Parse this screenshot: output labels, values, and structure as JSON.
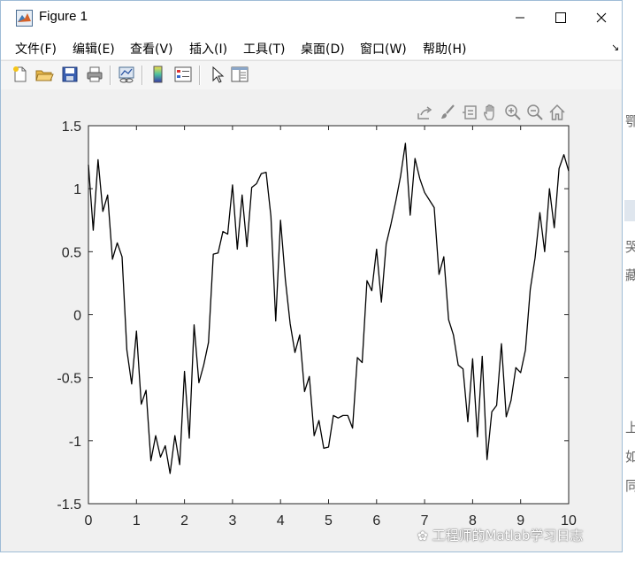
{
  "window": {
    "title": "Figure 1",
    "minimize_glyph": "—",
    "maximize_glyph": "☐",
    "close_glyph": "✕"
  },
  "menu": [
    {
      "label": "文件(F)"
    },
    {
      "label": "编辑(E)"
    },
    {
      "label": "查看(V)"
    },
    {
      "label": "插入(I)"
    },
    {
      "label": "工具(T)"
    },
    {
      "label": "桌面(D)"
    },
    {
      "label": "窗口(W)"
    },
    {
      "label": "帮助(H)"
    }
  ],
  "menu_overflow_glyph": "↘",
  "toolbar": [
    "new-figure-icon",
    "open-file-icon",
    "save-icon",
    "print-icon",
    "link-plot-icon",
    "colorbar-icon",
    "legend-icon",
    "select-pointer-icon",
    "property-inspector-icon"
  ],
  "axes_toolbar": [
    "export-icon",
    "brush-icon",
    "data-tips-icon",
    "pan-hand-icon",
    "zoom-in-icon",
    "zoom-out-icon",
    "home-icon"
  ],
  "colors": {
    "line": "#000000",
    "axes_bg": "#ffffff",
    "figure_bg": "#f0f0f0"
  },
  "chart_data": {
    "type": "line",
    "title": "",
    "xlabel": "",
    "ylabel": "",
    "xlim": [
      0,
      10
    ],
    "ylim": [
      -1.5,
      1.5
    ],
    "xticks": [
      "0",
      "1",
      "2",
      "3",
      "4",
      "5",
      "6",
      "7",
      "8",
      "9",
      "10"
    ],
    "yticks": [
      "-1.5",
      "-1",
      "-0.5",
      "0",
      "0.5",
      "1",
      "1.5"
    ],
    "grid": false,
    "series": [
      {
        "color": "#000000",
        "x": [
          0,
          0.1,
          0.2,
          0.3,
          0.4,
          0.5,
          0.6,
          0.7,
          0.8,
          0.9,
          1.0,
          1.1,
          1.2,
          1.3,
          1.4,
          1.5,
          1.6,
          1.7,
          1.8,
          1.9,
          2.0,
          2.1,
          2.2,
          2.3,
          2.4,
          2.5,
          2.6,
          2.7,
          2.8,
          2.9,
          3.0,
          3.1,
          3.2,
          3.3,
          3.4,
          3.5,
          3.6,
          3.7,
          3.8,
          3.9,
          4.0,
          4.1,
          4.2,
          4.3,
          4.4,
          4.5,
          4.6,
          4.7,
          4.8,
          4.9,
          5.0,
          5.1,
          5.2,
          5.3,
          5.4,
          5.5,
          5.6,
          5.7,
          5.8,
          5.9,
          6.0,
          6.1,
          6.2,
          6.3,
          6.4,
          6.5,
          6.6,
          6.7,
          6.8,
          6.9,
          7.0,
          7.1,
          7.2,
          7.3,
          7.4,
          7.5,
          7.6,
          7.7,
          7.8,
          7.9,
          8.0,
          8.1,
          8.2,
          8.3,
          8.4,
          8.5,
          8.6,
          8.7,
          8.8,
          8.9,
          9.0,
          9.1,
          9.2,
          9.3,
          9.4,
          9.5,
          9.6,
          9.7,
          9.8,
          9.9,
          10.0
        ],
        "y": [
          1.19,
          0.67,
          1.23,
          0.82,
          0.95,
          0.44,
          0.57,
          0.46,
          -0.28,
          -0.55,
          -0.13,
          -0.71,
          -0.6,
          -1.16,
          -0.96,
          -1.13,
          -1.04,
          -1.26,
          -0.96,
          -1.19,
          -0.45,
          -0.98,
          -0.08,
          -0.54,
          -0.4,
          -0.22,
          0.48,
          0.49,
          0.66,
          0.64,
          1.03,
          0.52,
          0.95,
          0.54,
          1.01,
          1.04,
          1.12,
          1.13,
          0.78,
          -0.05,
          0.75,
          0.28,
          -0.07,
          -0.3,
          -0.16,
          -0.61,
          -0.49,
          -0.96,
          -0.84,
          -1.06,
          -1.05,
          -0.8,
          -0.82,
          -0.8,
          -0.8,
          -0.9,
          -0.34,
          -0.38,
          0.27,
          0.19,
          0.52,
          0.1,
          0.56,
          0.72,
          0.9,
          1.1,
          1.36,
          0.79,
          1.24,
          1.08,
          0.97,
          0.91,
          0.85,
          0.32,
          0.46,
          -0.04,
          -0.16,
          -0.4,
          -0.43,
          -0.85,
          -0.35,
          -0.97,
          -0.33,
          -1.15,
          -0.77,
          -0.72,
          -0.23,
          -0.81,
          -0.68,
          -0.42,
          -0.46,
          -0.28,
          0.2,
          0.45,
          0.81,
          0.5,
          1.0,
          0.69,
          1.16,
          1.27,
          1.14
        ]
      }
    ]
  },
  "watermark": {
    "text": "工程师的Matlab学习日志"
  },
  "background_fragments": [
    "鄂",
    "哭",
    "藏",
    "上",
    "如",
    "同"
  ]
}
